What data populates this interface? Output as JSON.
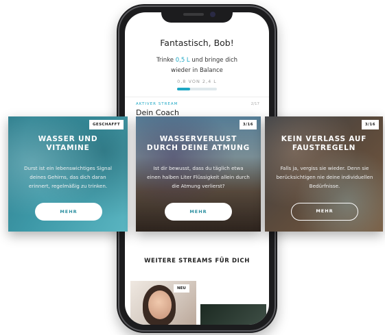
{
  "header": {
    "greeting": "Fantastisch, Bob!",
    "sub_line1_pre": "Trinke ",
    "sub_line1_amount": "0,5 L",
    "sub_line1_post": " und bringe dich",
    "sub_line2": "wieder in Balance",
    "progress_label": "0,8 VON 2,4 L",
    "progress_fraction": 0.33
  },
  "stream": {
    "label": "AKTIVER STREAM",
    "title": "Dein Coach",
    "count": "2/17"
  },
  "cards": [
    {
      "badge": "GESCHAFFT",
      "title_line1": "WASSER UND",
      "title_line2": "VITAMINE",
      "body": "Durst ist ein lebenswichtiges Signal deines Gehirns, das dich daran erinnert, regelmäßig zu trinken.",
      "button": "MEHR"
    },
    {
      "badge": "3/16",
      "title_line1": "WASSERVERLUST",
      "title_line2": "DURCH DEINE ATMUNG",
      "body": "Ist dir bewusst, dass du täglich etwa einen halben Liter Flüssigkeit allein durch die Atmung verlierst?",
      "button": "MEHR"
    },
    {
      "badge": "3/16",
      "title_line1": "KEIN VERLASS AUF",
      "title_line2": "FAUSTREGELN",
      "body": "Falls ja, vergiss sie wieder. Denn sie berücksichtigen nie deine individuellen Bedürfnisse.",
      "button": "MEHR"
    }
  ],
  "more": {
    "title": "WEITERE STREAMS FÜR DICH",
    "badge": "NEU"
  },
  "colors": {
    "accent": "#1ea7c4"
  }
}
